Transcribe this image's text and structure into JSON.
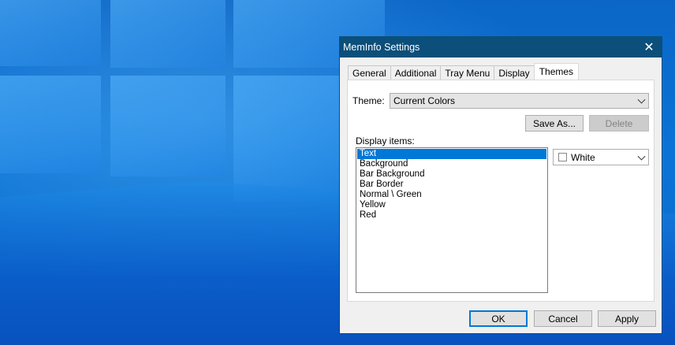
{
  "dialog": {
    "title": "MemInfo Settings",
    "tabs": [
      "General",
      "Additional",
      "Tray Menu",
      "Display",
      "Themes"
    ],
    "active_tab": "Themes",
    "theme_label": "Theme:",
    "theme_value": "Current Colors",
    "save_as_label": "Save As...",
    "delete_label": "Delete",
    "display_items_label": "Display items:",
    "display_items": [
      "Text",
      "Background",
      "Bar Background",
      "Bar Border",
      "Normal \\ Green",
      "Yellow",
      "Red"
    ],
    "selected_item": "Text",
    "color_value": "White",
    "ok_label": "OK",
    "cancel_label": "Cancel",
    "apply_label": "Apply"
  },
  "colors": {
    "titlebar": "#0b4f7a",
    "selection": "#0078d7",
    "swatch": "#ffffff"
  }
}
